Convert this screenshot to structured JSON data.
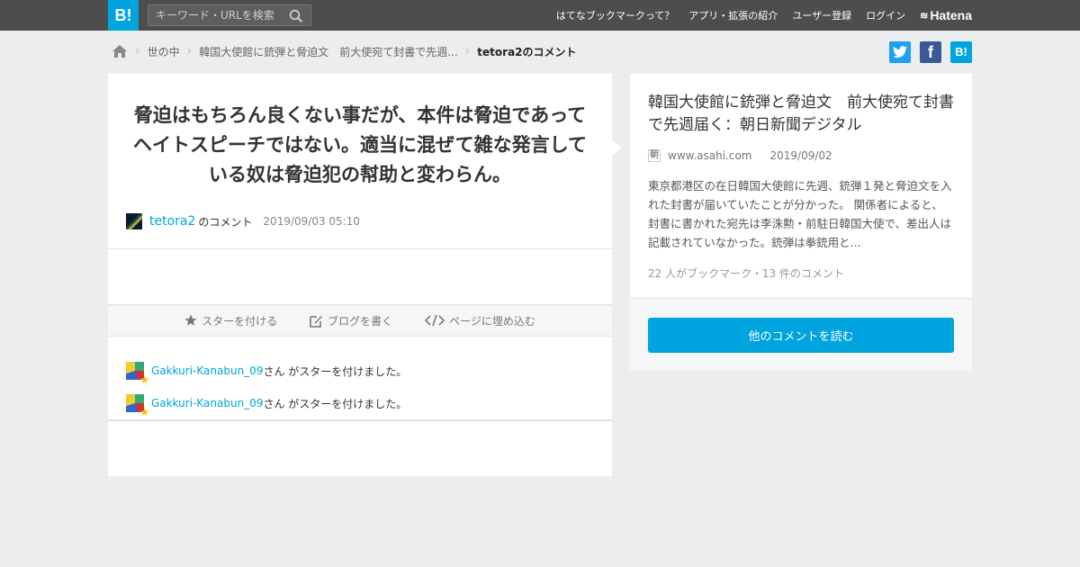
{
  "header": {
    "logo": "B!",
    "search_placeholder": "キーワード・URLを検索",
    "nav": [
      "はてなブックマークって？",
      "アプリ・拡張の紹介",
      "ユーザー登録",
      "ログイン"
    ],
    "brand": "Hatena"
  },
  "breadcrumb": {
    "items": [
      "世の中",
      "韓国大使館に銃弾と脅迫文　前大使宛て封書で先週..."
    ],
    "current": "tetora2のコメント"
  },
  "share": {
    "twitter": "t",
    "facebook": "f",
    "hatena": "B!"
  },
  "comment": {
    "text": "脅迫はもちろん良くない事だが、本件は脅迫であってヘイトスピーチではない。適当に混ぜて雑な発言している奴は脅迫犯の幇助と変わらん。",
    "user": "tetora2",
    "suffix": "のコメント",
    "date": "2019/09/03 05:10"
  },
  "actions": {
    "star": "スターを付ける",
    "blog": "ブログを書く",
    "embed": "ページに埋め込む"
  },
  "stars": [
    {
      "user": "Gakkuri-Kanabun_09",
      "text": "さん がスターを付けました。"
    },
    {
      "user": "Gakkuri-Kanabun_09",
      "text": "さん がスターを付けました。"
    }
  ],
  "article": {
    "title": "韓国大使館に銃弾と脅迫文　前大使宛て封書で先週届く：朝日新聞デジタル",
    "favicon": "朝",
    "domain": "www.asahi.com",
    "date": "2019/09/02",
    "summary": "東京都港区の在日韓国大使館に先週、銃弾１発と脅迫文を入れた封書が届いていたことが分かった。 関係者によると、封書に書かれた宛先は李洙勲・前駐日韓国大使で、差出人は記載されていなかった。銃弾は拳銃用と...",
    "counts": "22 人がブックマーク・13 件のコメント",
    "more_button": "他のコメントを読む"
  },
  "colors": {
    "accent": "#00a4de",
    "header_bg": "#4d4d4d",
    "page_bg": "#ebedee"
  }
}
